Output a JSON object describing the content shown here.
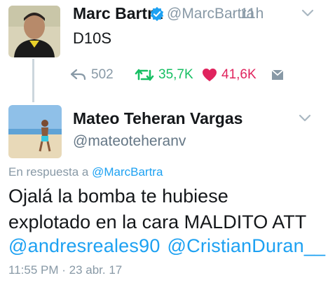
{
  "original": {
    "display_name": "Marc Bartra",
    "handle": "@MarcBartra",
    "time_sep": "·",
    "time": "11h",
    "text": "D10S",
    "reply_count": "502",
    "retweet_count": "35,7K",
    "like_count": "41,6K"
  },
  "reply": {
    "display_name": "Mateo Teheran Vargas",
    "handle": "@mateoteheranv",
    "in_reply_prefix": "En respuesta a",
    "in_reply_handle": "@MarcBartra",
    "line1": "Ojalá la bomba te hubiese",
    "line2": "explotado en la cara MALDITO ATT",
    "mention1": "@andresreales90",
    "mention2": "@CristianDuran__",
    "timestamp": "11:55 PM · 23 abr. 17"
  },
  "colors": {
    "link": "#1da1f2",
    "muted": "#8899a6",
    "retweet": "#17bf63",
    "like": "#e0245e"
  },
  "icons": [
    "verified-badge-icon",
    "chevron-down-icon",
    "reply-icon",
    "retweet-icon",
    "heart-icon",
    "direct-message-icon"
  ]
}
